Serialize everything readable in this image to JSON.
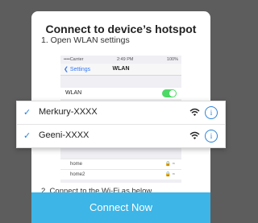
{
  "dialog": {
    "title": "Connect to device’s hotspot",
    "step1": "1. Open WLAN settings",
    "step2": "2. Connect to the Wi-Fi as below",
    "button_label": "Connect Now"
  },
  "phone": {
    "carrier": "••••Carrier",
    "time": "2:49 PM",
    "battery": "100%",
    "back_label": "Settings",
    "nav_title": "WLAN",
    "wlan_label": "WLAN",
    "wlan_on": true,
    "background_networks": [
      "home",
      "home2"
    ]
  },
  "networks": [
    {
      "name": "Merkury-XXXX",
      "selected": true
    },
    {
      "name": "Geeni-XXXX",
      "selected": true
    }
  ],
  "colors": {
    "accent": "#3db5e6",
    "check": "#2b82d9",
    "overlay": "#5d5d5d"
  },
  "icons": [
    "check-icon",
    "wifi-icon",
    "info-icon",
    "lock-icon",
    "chevron-left-icon"
  ]
}
